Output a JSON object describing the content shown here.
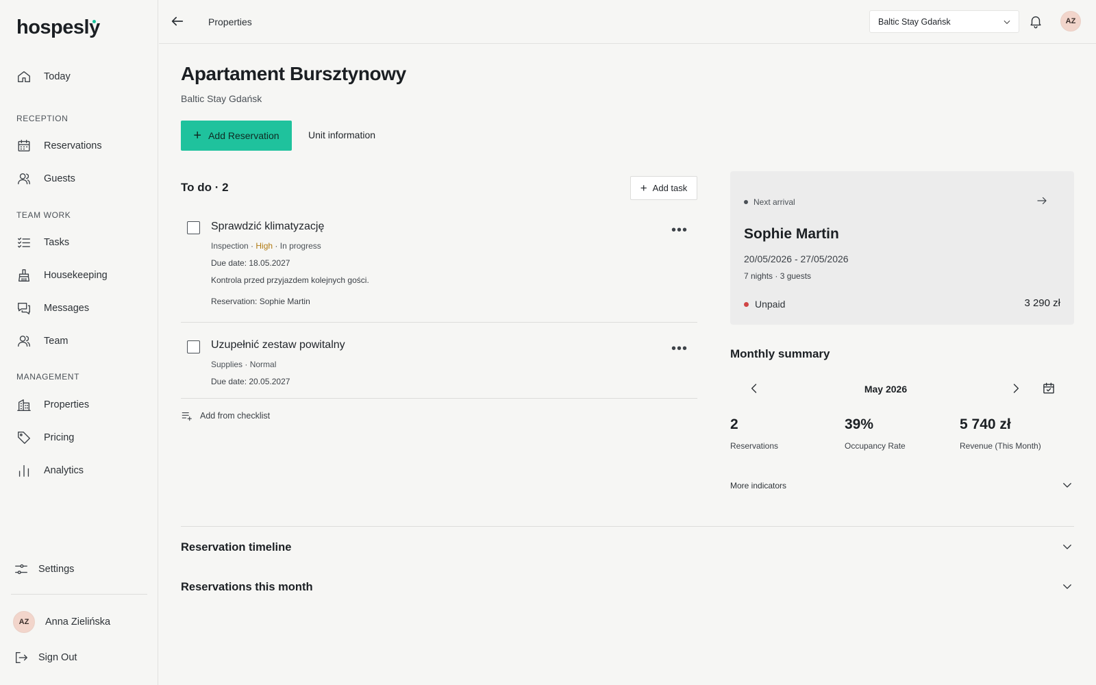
{
  "app": {
    "logo": "hospesly",
    "accent": "#1fc29d"
  },
  "sidebar": {
    "today": "Today",
    "sections": {
      "reception": "RECEPTION",
      "team_work": "TEAM WORK",
      "management": "MANAGEMENT"
    },
    "items": {
      "reservations": "Reservations",
      "guests": "Guests",
      "tasks": "Tasks",
      "housekeeping": "Housekeeping",
      "messages": "Messages",
      "team": "Team",
      "properties": "Properties",
      "pricing": "Pricing",
      "analytics": "Analytics"
    },
    "settings": "Settings",
    "user": {
      "initials": "AZ",
      "name": "Anna Zielińska"
    },
    "sign_out": "Sign Out"
  },
  "topbar": {
    "breadcrumb": "Properties",
    "property_select": "Baltic Stay Gdańsk",
    "avatar_initials": "AZ"
  },
  "page": {
    "title": "Apartament Bursztynowy",
    "subtitle": "Baltic Stay Gdańsk",
    "add_reservation": "Add Reservation",
    "unit_information": "Unit information"
  },
  "todo": {
    "title": "To do · 2",
    "add_task": "Add task",
    "tasks": [
      {
        "title": "Sprawdzić klimatyzację",
        "category": "Inspection",
        "priority": "High",
        "status": "In progress",
        "due": "Due date: 18.05.2027",
        "description": "Kontrola przed przyjazdem kolejnych gości.",
        "reservation": "Reservation: Sophie Martin",
        "done": false
      },
      {
        "title": "Uzupełnić zestaw powitalny",
        "category": "Supplies",
        "priority": "Normal",
        "due": "Due date: 20.05.2027",
        "done": false
      }
    ],
    "add_from_checklist": "Add from checklist"
  },
  "next_arrival": {
    "label": "Next arrival",
    "guest": "Sophie Martin",
    "dates": "20/05/2026 - 27/05/2026",
    "info": "7 nights · 3 guests",
    "payment_status": "Unpaid",
    "amount": "3 290 zł"
  },
  "monthly_summary": {
    "title": "Monthly summary",
    "month": "May 2026",
    "stats": [
      {
        "value": "2",
        "label": "Reservations"
      },
      {
        "value": "39%",
        "label": "Occupancy Rate"
      },
      {
        "value": "5 740 zł",
        "label": "Revenue (This Month)"
      }
    ],
    "more_indicators": "More indicators"
  },
  "sections": {
    "reservation_timeline": "Reservation timeline",
    "reservations_this_month": "Reservations this month"
  }
}
